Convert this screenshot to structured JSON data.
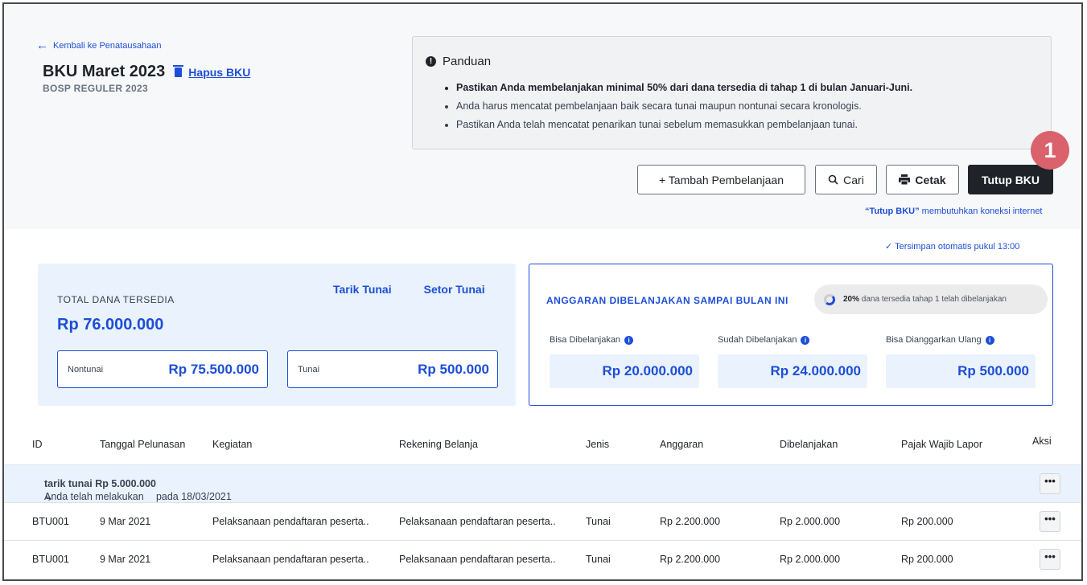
{
  "header": {
    "back_label": "Kembali ke Penatausahaan",
    "title": "BKU Maret 2023",
    "delete_label": "Hapus BKU",
    "subtitle": "BOSP REGULER 2023"
  },
  "guide": {
    "title": "Panduan",
    "items": [
      "Pastikan Anda membelanjakan minimal 50% dari dana tersedia di tahap 1 di bulan Januari-Juni.",
      "Anda harus mencatat pembelanjaan baik secara tunai maupun nontunai secara kronologis.",
      "Pastikan Anda telah mencatat penarikan tunai sebelum memasukkan pembelanjaan tunai."
    ]
  },
  "toolbar": {
    "add_label": "+ Tambah Pembelanjaan",
    "search_label": "Cari",
    "print_label": "Cetak",
    "close_label": "Tutup BKU",
    "badge": "1",
    "note_strong": "“Tutup BKU”",
    "note_rest": " membutuhkan koneksi internet"
  },
  "autosave": "Tersimpan otomatis pukul 13:00",
  "funds": {
    "label": "TOTAL DANA TERSEDIA",
    "amount": "Rp 76.000.000",
    "withdraw_label": "Tarik Tunai",
    "deposit_label": "Setor Tunai",
    "noncash_label": "Nontunai",
    "noncash_value": "Rp 75.500.000",
    "cash_label": "Tunai",
    "cash_value": "Rp 500.000"
  },
  "budget": {
    "title": "ANGGARAN DIBELANJAKAN SAMPAI BULAN INI",
    "progress_pct": "20%",
    "progress_text": " dana tersedia tahap 1 telah dibelanjakan",
    "progress_fraction": 0.2,
    "stats": [
      {
        "label": "Bisa Dibelanjakan",
        "value": "Rp 20.000.000"
      },
      {
        "label": "Sudah Dibelanjakan",
        "value": "Rp 24.000.000"
      },
      {
        "label": "Bisa Dianggarkan Ulang",
        "value": "Rp 500.000"
      }
    ]
  },
  "table": {
    "headers": [
      "ID",
      "Tanggal Pelunasan",
      "Kegiatan",
      "Rekening Belanja",
      "Jenis",
      "Anggaran",
      "Dibelanjakan",
      "Pajak Wajib Lapor",
      "Aksi"
    ],
    "info_row": {
      "prefix": "Anda telah melakukan ",
      "strong": "tarik tunai Rp 5.000.000",
      "suffix": " pada 18/03/2021"
    },
    "rows": [
      {
        "id": "BTU001",
        "date": "9 Mar 2021",
        "activity": "Pelaksanaan pendaftaran peserta..",
        "account": "Pelaksanaan pendaftaran peserta..",
        "type": "Tunai",
        "budget": "Rp 2.200.000",
        "spent": "Rp 2.000.000",
        "tax": "Rp 200.000"
      },
      {
        "id": "BTU001",
        "date": "9 Mar 2021",
        "activity": "Pelaksanaan pendaftaran peserta..",
        "account": "Pelaksanaan pendaftaran peserta..",
        "type": "Tunai",
        "budget": "Rp 2.200.000",
        "spent": "Rp 2.000.000",
        "tax": "Rp 200.000"
      }
    ],
    "action_label": "•••"
  }
}
